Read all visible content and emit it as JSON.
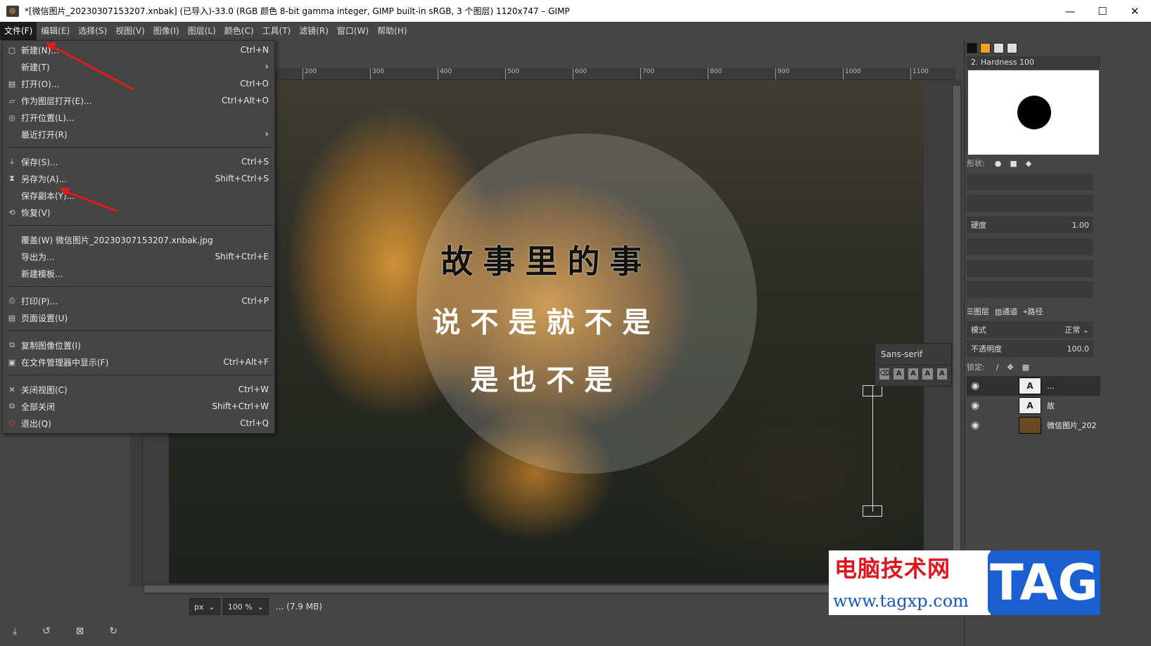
{
  "window": {
    "title": "*[微信图片_20230307153207.xnbak] (已导入)-33.0 (RGB 颜色 8-bit gamma integer, GIMP built-in sRGB, 3 个图层) 1120x747 – GIMP",
    "minimize": "—",
    "maximize": "☐",
    "close": "✕"
  },
  "menubar": [
    "文件(F)",
    "编辑(E)",
    "选择(S)",
    "视图(V)",
    "图像(I)",
    "图层(L)",
    "颜色(C)",
    "工具(T)",
    "滤镜(R)",
    "窗口(W)",
    "帮助(H)"
  ],
  "file_menu": {
    "items": [
      {
        "label": "新建(N)...",
        "shortcut": "Ctrl+N",
        "icon": "new-doc-icon"
      },
      {
        "label": "新建(T)",
        "shortcut": "",
        "submenu": true
      },
      {
        "label": "打开(O)...",
        "shortcut": "Ctrl+O",
        "icon": "open-icon"
      },
      {
        "label": "作为图层打开(E)...",
        "shortcut": "Ctrl+Alt+O",
        "icon": "open-layer-icon"
      },
      {
        "label": "打开位置(L)...",
        "shortcut": "",
        "icon": "location-icon"
      },
      {
        "label": "最近打开(R)",
        "shortcut": "",
        "submenu": true
      },
      {
        "label": "保存(S)...",
        "shortcut": "Ctrl+S",
        "icon": "save-icon"
      },
      {
        "label": "另存为(A)...",
        "shortcut": "Shift+Ctrl+S",
        "icon": "save-as-icon"
      },
      {
        "label": "保存副本(Y)...",
        "shortcut": ""
      },
      {
        "label": "恢复(V)",
        "shortcut": "",
        "icon": "revert-icon"
      },
      {
        "label": "覆盖(W) 微信图片_20230307153207.xnbak.jpg",
        "shortcut": ""
      },
      {
        "label": "导出为...",
        "shortcut": "Shift+Ctrl+E"
      },
      {
        "label": "新建模板...",
        "shortcut": ""
      },
      {
        "label": "打印(P)...",
        "shortcut": "Ctrl+P",
        "icon": "print-icon"
      },
      {
        "label": "页面设置(U)",
        "shortcut": "",
        "icon": "page-setup-icon"
      },
      {
        "label": "复制图像位置(I)",
        "shortcut": "",
        "icon": "copy-location-icon"
      },
      {
        "label": "在文件管理器中显示(F)",
        "shortcut": "Ctrl+Alt+F",
        "icon": "file-manager-icon"
      },
      {
        "label": "关闭视图(C)",
        "shortcut": "Ctrl+W",
        "icon": "close-view-icon"
      },
      {
        "label": "全部关闭",
        "shortcut": "Shift+Ctrl+W",
        "icon": "close-all-icon"
      },
      {
        "label": "退出(Q)",
        "shortcut": "Ctrl+Q",
        "icon": "quit-icon"
      }
    ]
  },
  "ruler": {
    "h_labels": [
      "200",
      "300",
      "400",
      "500",
      "600",
      "700",
      "800",
      "900",
      "1000",
      "1100"
    ]
  },
  "canvas": {
    "line1": "故事里的事",
    "line2": "说不是就不是",
    "line3": "是也不是",
    "font_box": "Sans-serif"
  },
  "statusbar": {
    "unit": "px",
    "zoom": "100 %",
    "info": "... (7.9 MB)"
  },
  "brushes": {
    "name": "2. Hardness 100",
    "shape_label": "形状:",
    "hardness_label": "硬度",
    "hardness_value": "1.00"
  },
  "layers_panel": {
    "tabs": [
      "图层",
      "通道",
      "路径"
    ],
    "mode_label": "模式",
    "mode_value": "正常",
    "opacity_label": "不透明度",
    "opacity_value": "100.0",
    "lock_label": "锁定:",
    "layers": [
      {
        "name": "...",
        "type": "text",
        "selected": true
      },
      {
        "name": "故",
        "type": "text",
        "selected": false
      },
      {
        "name": "微信图片_202",
        "type": "image",
        "selected": false
      }
    ]
  },
  "watermark": {
    "cn": "电脑技术网",
    "url": "www.tagxp.com",
    "tag": "TAG"
  },
  "colors": {
    "menu_bg": "#454545",
    "accent_arrow": "#e01b1b",
    "watermark_red": "#e0141b",
    "watermark_blue": "#1a5fd0"
  }
}
